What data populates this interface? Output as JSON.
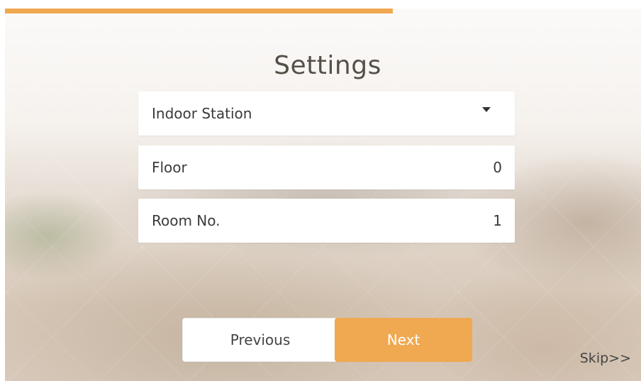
{
  "progress": {
    "value": 0.61,
    "color": "#f0a851"
  },
  "title": "Settings",
  "device_type": {
    "selected": "Indoor Station",
    "icon": "dropdown-caret-icon"
  },
  "floor": {
    "label": "Floor",
    "value": "0"
  },
  "room": {
    "label": "Room No.",
    "value": "1"
  },
  "buttons": {
    "previous": "Previous",
    "next": "Next",
    "skip": "Skip>>"
  },
  "colors": {
    "accent": "#f0a851",
    "card": "#ffffff",
    "text": "#3a3a3a"
  }
}
